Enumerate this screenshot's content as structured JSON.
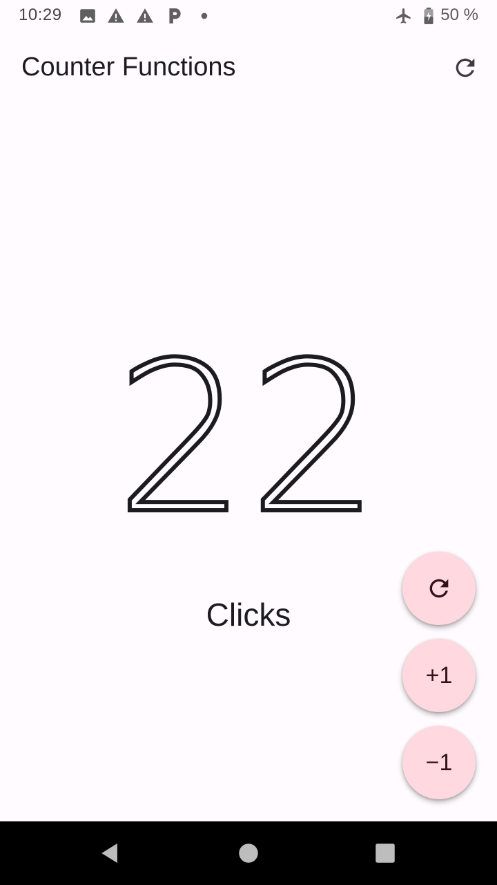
{
  "status_bar": {
    "time": "10:29",
    "battery_text": "50 %",
    "icons": [
      "image-icon",
      "warning-icon",
      "warning-icon",
      "parking-icon",
      "dot-icon",
      "airplane-icon",
      "battery-icon"
    ]
  },
  "app_bar": {
    "title": "Counter Functions",
    "action_icon": "refresh-icon"
  },
  "counter": {
    "value": "22",
    "label": "Clicks"
  },
  "fabs": {
    "reset_icon": "refresh-icon",
    "plus_label": "+1",
    "minus_label": "−1"
  },
  "colors": {
    "background": "#fffbfe",
    "fab_background": "#ffd9df",
    "fab_foreground": "#31111d",
    "text": "#1c1b1f",
    "nav_bar": "#000000"
  },
  "nav_bar": {
    "icons": [
      "back-icon",
      "home-icon",
      "recents-icon"
    ]
  }
}
